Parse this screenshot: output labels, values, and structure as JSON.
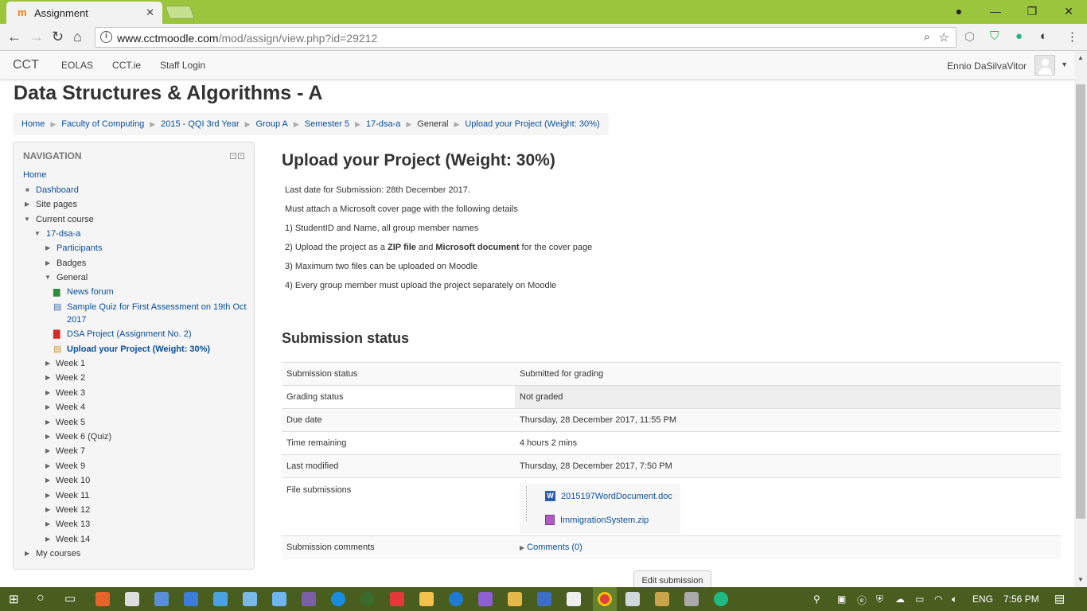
{
  "browser": {
    "tab_title": "Assignment",
    "url_domain": "www.cctmoodle.com",
    "url_path": "/mod/assign/view.php?id=29212"
  },
  "moodle_bar": {
    "brand": "CCT",
    "links": [
      "EOLAS",
      "CCT.ie",
      "Staff Login"
    ],
    "user": "Ennio DaSilvaVitor"
  },
  "page_title": "Data Structures & Algorithms - A",
  "breadcrumb": [
    "Home",
    "Faculty of Computing",
    "2015 - QQI 3rd Year",
    "Group A",
    "Semester 5",
    "17-dsa-a",
    "General",
    "Upload your Project (Weight: 30%)"
  ],
  "navigation": {
    "heading": "NAVIGATION",
    "items": [
      {
        "label": "Home"
      },
      {
        "label": "Dashboard"
      },
      {
        "label": "Site pages"
      },
      {
        "label": "Current course"
      },
      {
        "label": "17-dsa-a"
      },
      {
        "label": "Participants"
      },
      {
        "label": "Badges"
      },
      {
        "label": "General"
      },
      {
        "label": "News forum"
      },
      {
        "label": "Sample Quiz for First Assessment on 19th Oct"
      },
      {
        "label": "2017"
      },
      {
        "label": "DSA Project (Assignment No. 2)"
      },
      {
        "label": "Upload your Project (Weight: 30%)"
      },
      {
        "label": "Week 1"
      },
      {
        "label": "Week 2"
      },
      {
        "label": "Week 3"
      },
      {
        "label": "Week 4"
      },
      {
        "label": "Week 5"
      },
      {
        "label": "Week 6 (Quiz)"
      },
      {
        "label": "Week 7"
      },
      {
        "label": "Week 9"
      },
      {
        "label": "Week 10"
      },
      {
        "label": "Week 11"
      },
      {
        "label": "Week 12"
      },
      {
        "label": "Week 13"
      },
      {
        "label": "Week 14"
      },
      {
        "label": "My courses"
      }
    ]
  },
  "assignment": {
    "title": "Upload your Project (Weight: 30%)",
    "line1": "Last date for Submission: 28th December 2017.",
    "line2": "Must attach a Microsoft cover page with the following details",
    "line3": "1) StudentID and Name, all group member names",
    "line4_a": "2) Upload the project as a ",
    "line4_b": "ZIP file",
    "line4_c": " and ",
    "line4_d": "Microsoft document",
    "line4_e": " for the cover page",
    "line5": "3) Maximum two files can be uploaded on Moodle",
    "line6": "4) Every group member must upload the project separately on Moodle"
  },
  "submission": {
    "heading": "Submission status",
    "rows": [
      {
        "label": "Submission status",
        "value": "Submitted for grading"
      },
      {
        "label": "Grading status",
        "value": "Not graded"
      },
      {
        "label": "Due date",
        "value": "Thursday, 28 December 2017, 11:55 PM"
      },
      {
        "label": "Time remaining",
        "value": "4 hours 2 mins"
      },
      {
        "label": "Last modified",
        "value": "Thursday, 28 December 2017, 7:50 PM"
      }
    ],
    "files_label": "File submissions",
    "files": [
      "2015197WordDocument.doc",
      "ImmigrationSystem.zip"
    ],
    "comments_label": "Submission comments",
    "comments_link": "Comments (0)",
    "edit_button": "Edit submission"
  },
  "taskbar": {
    "language": "ENG",
    "time": "7:56 PM"
  },
  "colors": {
    "browser_frame": "#9bc53d",
    "taskbar": "#495e1e",
    "link": "#0a4f99"
  }
}
